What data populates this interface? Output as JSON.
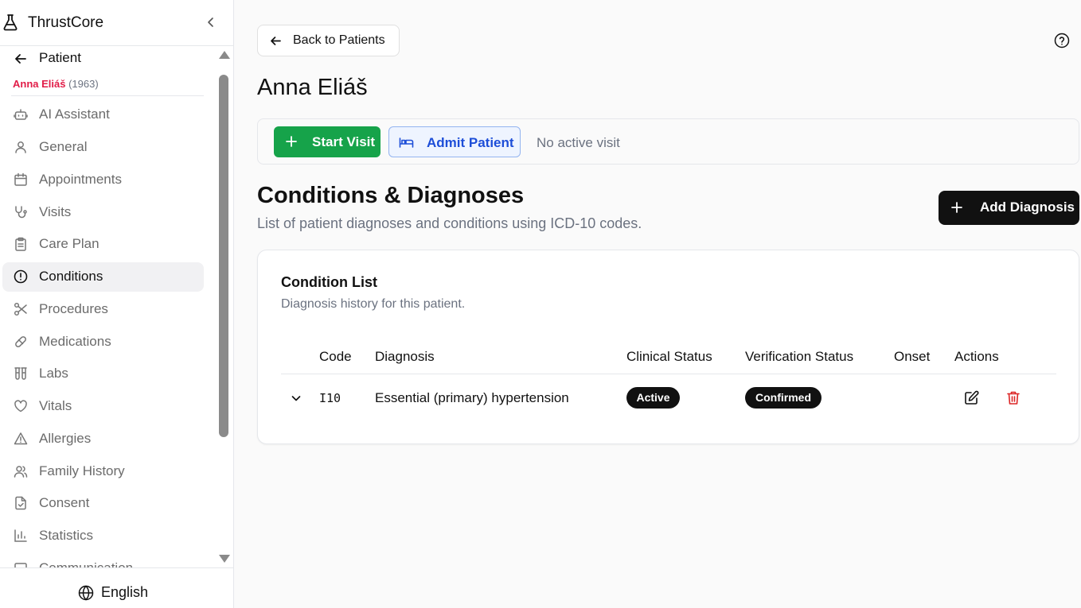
{
  "app": {
    "name": "ThrustCore"
  },
  "patient": {
    "section_title": "Patient",
    "name": "Anna Eliáš",
    "year": "(1963)"
  },
  "sidebar": {
    "items": [
      {
        "label": "AI Assistant",
        "icon": "robot-icon"
      },
      {
        "label": "General",
        "icon": "user-icon"
      },
      {
        "label": "Appointments",
        "icon": "calendar-icon"
      },
      {
        "label": "Visits",
        "icon": "stethoscope-icon"
      },
      {
        "label": "Care Plan",
        "icon": "clipboard-icon"
      },
      {
        "label": "Conditions",
        "icon": "alert-circle-icon",
        "active": true
      },
      {
        "label": "Procedures",
        "icon": "scissors-icon"
      },
      {
        "label": "Medications",
        "icon": "pill-icon"
      },
      {
        "label": "Labs",
        "icon": "test-tubes-icon"
      },
      {
        "label": "Vitals",
        "icon": "heart-icon"
      },
      {
        "label": "Allergies",
        "icon": "warning-triangle-icon"
      },
      {
        "label": "Family History",
        "icon": "users-icon"
      },
      {
        "label": "Consent",
        "icon": "file-check-icon"
      },
      {
        "label": "Statistics",
        "icon": "bar-chart-icon"
      },
      {
        "label": "Communication",
        "icon": "message-icon"
      }
    ]
  },
  "language": {
    "label": "English"
  },
  "header": {
    "back_label": "Back to Patients",
    "page_title": "Anna Eliáš"
  },
  "visit_bar": {
    "start_label": "Start Visit",
    "admit_label": "Admit Patient",
    "status": "No active visit"
  },
  "section": {
    "title": "Conditions & Diagnoses",
    "subtitle": "List of patient diagnoses and conditions using ICD-10 codes.",
    "add_label": "Add Diagnosis"
  },
  "card": {
    "title": "Condition List",
    "subtitle": "Diagnosis history for this patient.",
    "columns": [
      "Code",
      "Diagnosis",
      "Clinical Status",
      "Verification Status",
      "Onset",
      "Actions"
    ],
    "rows": [
      {
        "code": "I10",
        "diagnosis": "Essential (primary) hypertension",
        "clinical_status": "Active",
        "verification_status": "Confirmed",
        "onset": ""
      }
    ]
  },
  "colors": {
    "primary_green": "#16a34a",
    "admit_blue": "#1d4ed8",
    "delete_red": "#dc2626",
    "patient_name_pink": "#e11d48"
  }
}
